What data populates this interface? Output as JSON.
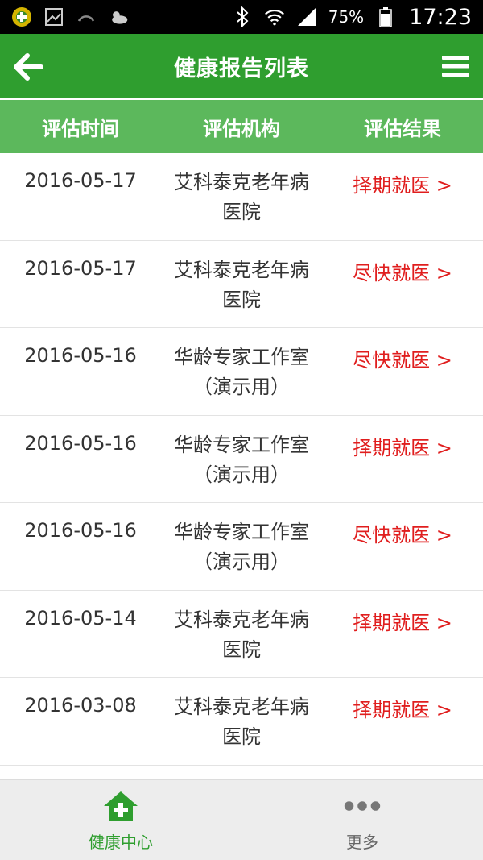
{
  "status_bar": {
    "battery": "75%",
    "time": "17:23"
  },
  "header": {
    "title": "健康报告列表"
  },
  "columns": {
    "time": "评估时间",
    "org": "评估机构",
    "result": "评估结果"
  },
  "reports": [
    {
      "date": "2016-05-17",
      "org_line1": "艾科泰克老年病",
      "org_line2": "医院",
      "result": "择期就医 >"
    },
    {
      "date": "2016-05-17",
      "org_line1": "艾科泰克老年病",
      "org_line2": "医院",
      "result": "尽快就医 >"
    },
    {
      "date": "2016-05-16",
      "org_line1": "华龄专家工作室",
      "org_line2": "（演示用）",
      "result": "尽快就医 >"
    },
    {
      "date": "2016-05-16",
      "org_line1": "华龄专家工作室",
      "org_line2": "（演示用）",
      "result": "择期就医 >"
    },
    {
      "date": "2016-05-16",
      "org_line1": "华龄专家工作室",
      "org_line2": "（演示用）",
      "result": "尽快就医 >"
    },
    {
      "date": "2016-05-14",
      "org_line1": "艾科泰克老年病",
      "org_line2": "医院",
      "result": "择期就医 >"
    },
    {
      "date": "2016-03-08",
      "org_line1": "艾科泰克老年病",
      "org_line2": "医院",
      "result": "择期就医 >"
    }
  ],
  "bottom_nav": {
    "health_center": "健康中心",
    "more": "更多"
  },
  "colors": {
    "header_green": "#2f9e2f",
    "column_green": "#5cb85c",
    "result_red": "#e01e1e"
  },
  "icons": {
    "back": "arrow-left-icon",
    "menu": "hamburger-menu-icon",
    "health_center": "house-plus-icon",
    "more": "three-dots-icon"
  }
}
